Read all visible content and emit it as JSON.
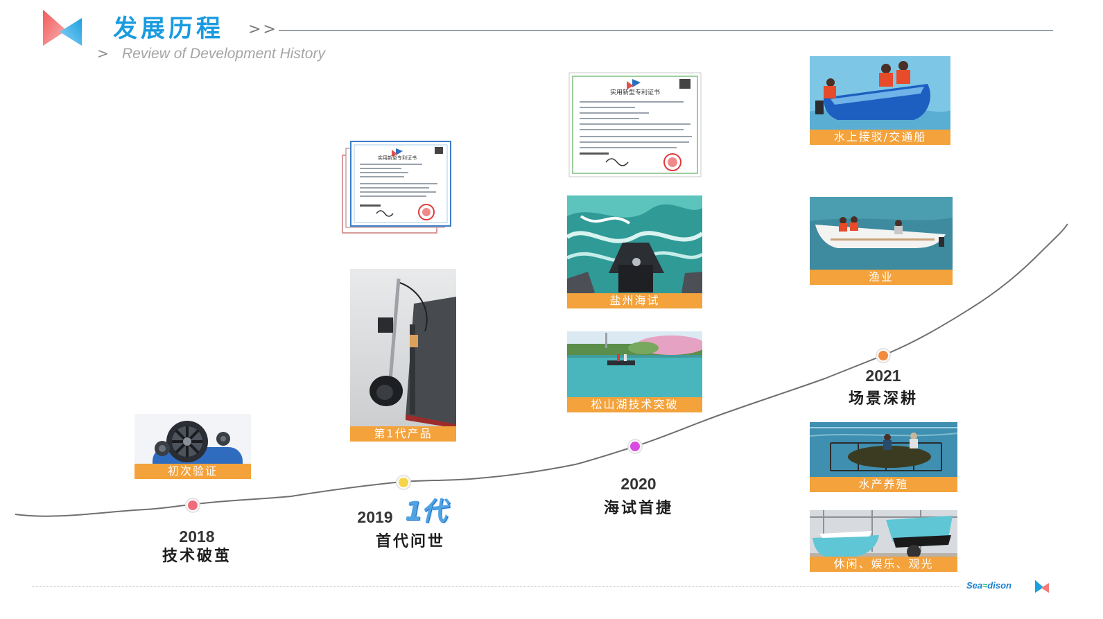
{
  "header": {
    "title": "发展历程",
    "title_arrows": ">>",
    "subtitle_arrow": ">",
    "subtitle": "Review of Development History"
  },
  "colors": {
    "accent_blue": "#1a9be0",
    "caption_orange": "#f3a23c",
    "dot_2018": "#ef6d7a",
    "dot_2019": "#f7d54a",
    "dot_2020": "#d94be0",
    "dot_2021": "#f28c3c"
  },
  "milestones": [
    {
      "year": "2018",
      "stage": "技术破茧"
    },
    {
      "year": "2019",
      "stage": "首代问世",
      "badge": "1代"
    },
    {
      "year": "2020",
      "stage": "海试首捷"
    },
    {
      "year": "2021",
      "stage": "场景深耕"
    }
  ],
  "cards": {
    "c2018": "初次验证",
    "c2019": "第1代产品",
    "c2020a": "盐州海试",
    "c2020b": "松山湖技术突破",
    "c2021a": "水上接驳/交通船",
    "c2021b": "渔业",
    "c2021c": "水产养殖",
    "c2021d": "休闲、娱乐、观光"
  },
  "certificate": {
    "heading": "实用新型专利证书"
  },
  "footer": {
    "brand_a": "Sea",
    "brand_b": "dison"
  }
}
